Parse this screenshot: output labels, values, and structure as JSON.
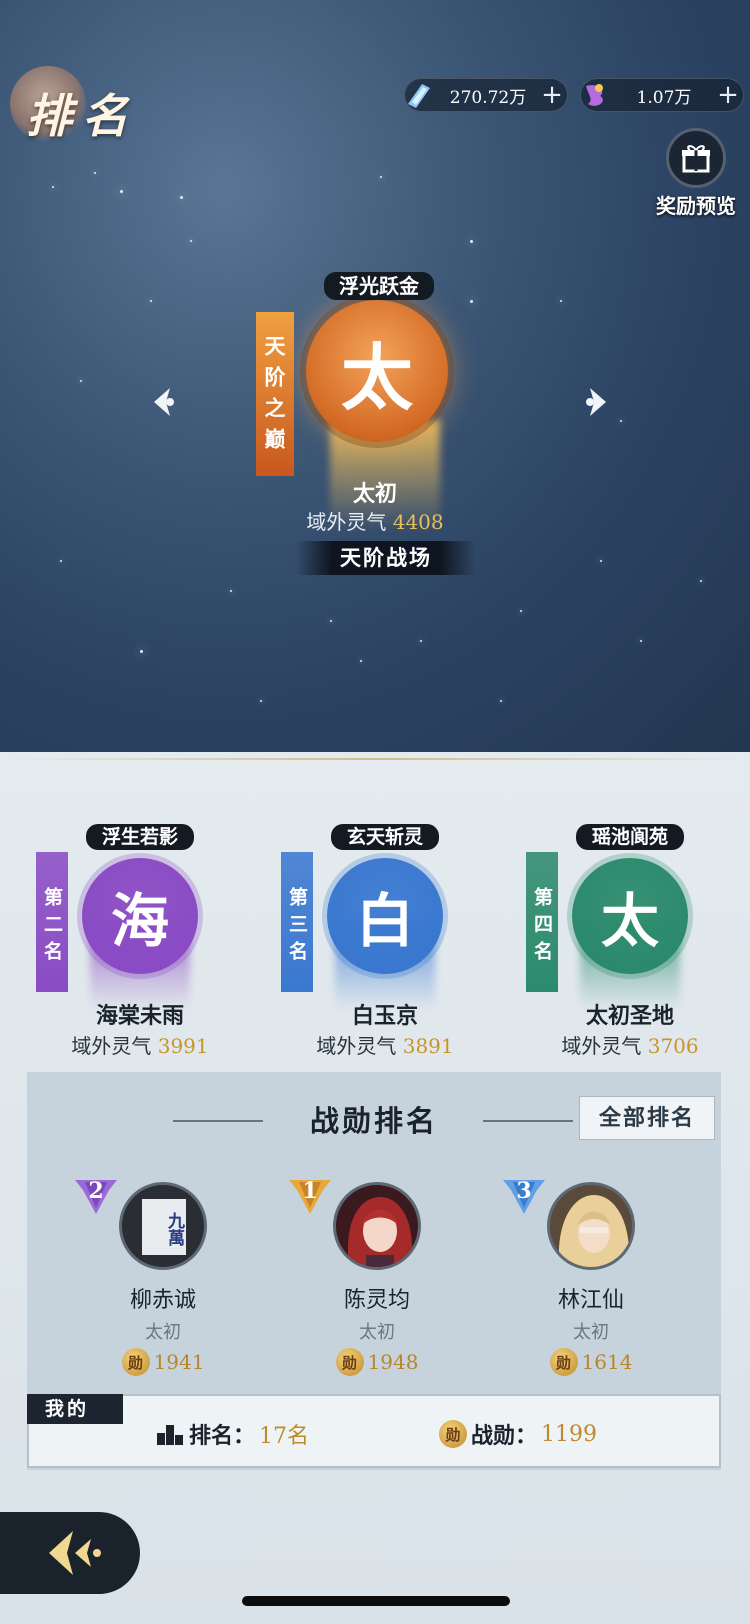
{
  "header": {
    "title": "排名"
  },
  "currencies": [
    {
      "icon": "blue-crystal-icon",
      "value": "270.72万"
    },
    {
      "icon": "purple-gem-icon",
      "value": "1.07万"
    }
  ],
  "reward_preview": {
    "label": "奖励预览"
  },
  "featured": {
    "rank_ribbon": "天阶之巅",
    "tag": "浮光跃金",
    "glyph": "太",
    "name": "太初",
    "stat_label": "域外灵气",
    "stat_value": "4408",
    "battlefield": "天阶战场",
    "color": "#e08236"
  },
  "ranks": [
    {
      "ribbon": "第二名",
      "tag": "浮生若影",
      "glyph": "海",
      "name": "海棠未雨",
      "stat_label": "域外灵气",
      "stat_value": "3991",
      "color": "#8a4bc4"
    },
    {
      "ribbon": "第三名",
      "tag": "玄天斩灵",
      "glyph": "白",
      "name": "白玉京",
      "stat_label": "域外灵气",
      "stat_value": "3891",
      "color": "#3a78d0"
    },
    {
      "ribbon": "第四名",
      "tag": "瑶池阆苑",
      "glyph": "太",
      "name": "太初圣地",
      "stat_label": "域外灵气",
      "stat_value": "3706",
      "color": "#2c8a6c"
    }
  ],
  "merit": {
    "title": "战勋排名",
    "all_button": "全部排名",
    "coin_glyph": "勋",
    "players": [
      {
        "rank": "2",
        "name": "柳赤诚",
        "guild": "太初",
        "score": "1941",
        "avatar_text": "九萬"
      },
      {
        "rank": "1",
        "name": "陈灵均",
        "guild": "太初",
        "score": "1948"
      },
      {
        "rank": "3",
        "name": "林江仙",
        "guild": "太初",
        "score": "1614"
      }
    ]
  },
  "mine": {
    "label": "我的",
    "rank_label": "排名：",
    "rank_value": "17名",
    "merit_label": "战勋：",
    "merit_value": "1199"
  }
}
